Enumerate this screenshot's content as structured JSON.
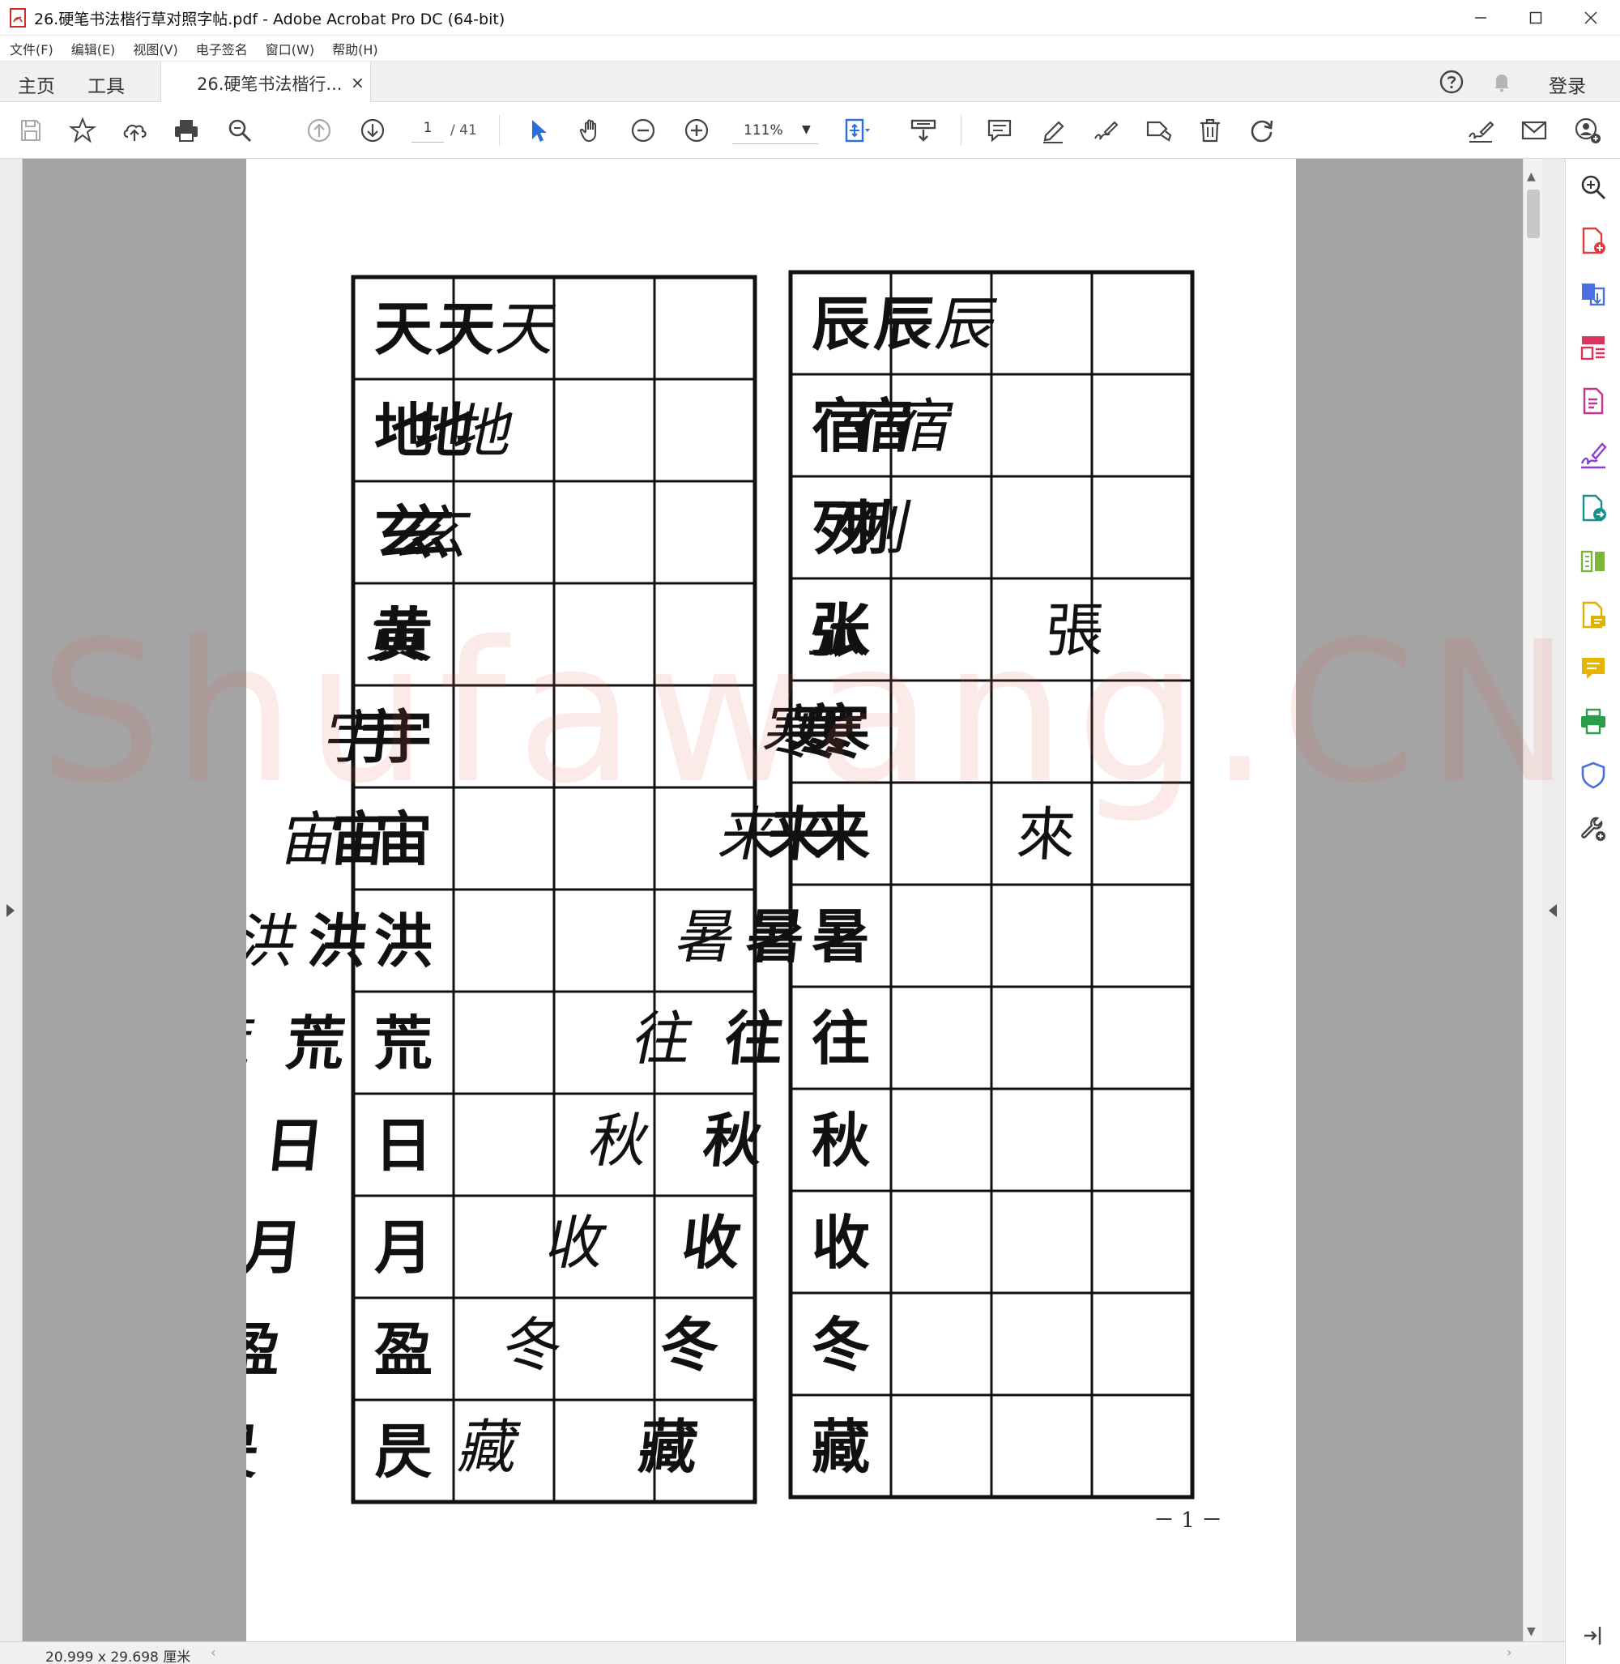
{
  "window": {
    "title": "26.硬笔书法楷行草对照字帖.pdf - Adobe Acrobat Pro DC (64-bit)",
    "controls": [
      "minimize",
      "maximize",
      "close"
    ]
  },
  "menu": [
    "文件(F)",
    "编辑(E)",
    "视图(V)",
    "电子签名",
    "窗口(W)",
    "帮助(H)"
  ],
  "tabs": {
    "home": "主页",
    "tools": "工具",
    "document": "26.硬笔书法楷行...",
    "close_glyph": "×",
    "login": "登录"
  },
  "toolbar": {
    "page_current": "1",
    "page_total": "/ 41",
    "zoom": "111%",
    "zoom_caret": "▼"
  },
  "document": {
    "left_table": {
      "rows": [
        [
          "天",
          "天",
          "天",
          ""
        ],
        [
          "地",
          "地",
          "地",
          ""
        ],
        [
          "玄",
          "玄",
          "玄",
          ""
        ],
        [
          "黄",
          "黄",
          "黄",
          ""
        ],
        [
          "宇",
          "宇",
          "宇",
          ""
        ],
        [
          "宙",
          "宙",
          "宙",
          ""
        ],
        [
          "洪",
          "洪",
          "洪",
          ""
        ],
        [
          "荒",
          "荒",
          "荒",
          ""
        ],
        [
          "日",
          "日",
          "日",
          ""
        ],
        [
          "月",
          "月",
          "月",
          ""
        ],
        [
          "盈",
          "盈",
          "盈",
          ""
        ],
        [
          "昃",
          "昃",
          "昃",
          ""
        ]
      ]
    },
    "right_table": {
      "rows": [
        [
          "辰",
          "辰",
          "辰",
          ""
        ],
        [
          "宿",
          "宿",
          "宿",
          ""
        ],
        [
          "列",
          "列",
          "列",
          ""
        ],
        [
          "张",
          "张",
          "张",
          "張"
        ],
        [
          "寒",
          "寒",
          "寒",
          ""
        ],
        [
          "来",
          "来",
          "来",
          "來"
        ],
        [
          "暑",
          "暑",
          "暑",
          ""
        ],
        [
          "往",
          "往",
          "往",
          ""
        ],
        [
          "秋",
          "秋",
          "秋",
          ""
        ],
        [
          "收",
          "收",
          "收",
          ""
        ],
        [
          "冬",
          "冬",
          "冬",
          ""
        ],
        [
          "藏",
          "藏",
          "藏",
          ""
        ]
      ]
    },
    "page_number": "－ 1 －",
    "watermark": "Shufawang.CN"
  },
  "status": {
    "page_size": "20.999 x 29.698 厘米"
  },
  "right_tools": [
    "zoom-tool-icon",
    "create-pdf-icon",
    "export-pdf-icon",
    "organize-pages-icon",
    "edit-pdf-icon",
    "fill-sign-icon",
    "combine-files-icon",
    "compare-files-icon",
    "send-for-comments-icon",
    "comment-icon",
    "print-production-icon",
    "protect-icon",
    "more-tools-icon"
  ],
  "colors": {
    "watermark": "#e85c52",
    "accent_blue": "#2a6fdb",
    "pane_gray": "#a4a4a4"
  }
}
